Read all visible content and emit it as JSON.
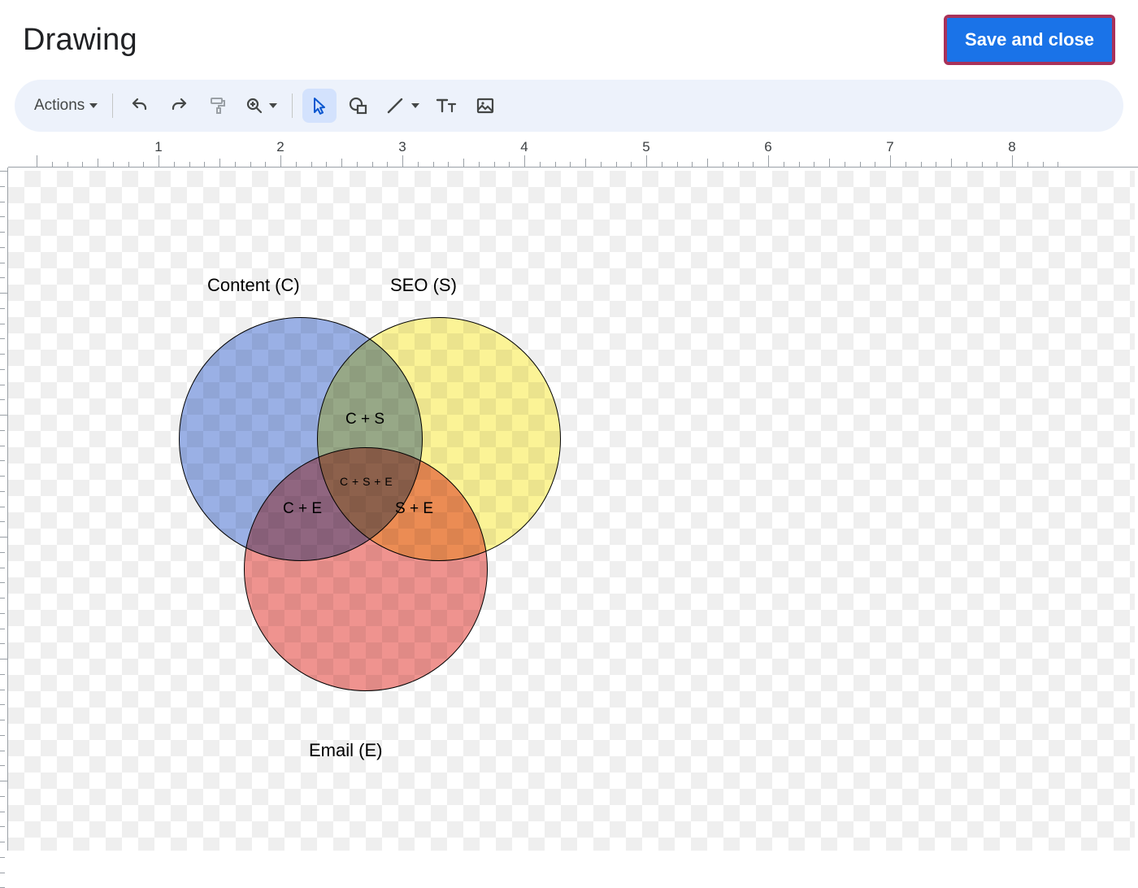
{
  "header": {
    "title": "Drawing",
    "save_label": "Save and close"
  },
  "toolbar": {
    "actions_label": "Actions"
  },
  "ruler": {
    "majors": [
      1,
      2,
      3,
      4,
      5,
      6,
      7,
      8
    ]
  },
  "chart_data": {
    "type": "venn",
    "sets": [
      {
        "id": "C",
        "label": "Content (C)",
        "color": "#7a96dc"
      },
      {
        "id": "S",
        "label": "SEO (S)",
        "color": "#f3eb79"
      },
      {
        "id": "E",
        "label": "Email (E)",
        "color": "#e97773"
      }
    ],
    "intersections": [
      {
        "sets": [
          "C",
          "S"
        ],
        "label": "C + S"
      },
      {
        "sets": [
          "C",
          "E"
        ],
        "label": "C + E"
      },
      {
        "sets": [
          "S",
          "E"
        ],
        "label": "S + E"
      },
      {
        "sets": [
          "C",
          "S",
          "E"
        ],
        "label": "C + S + E"
      }
    ]
  }
}
